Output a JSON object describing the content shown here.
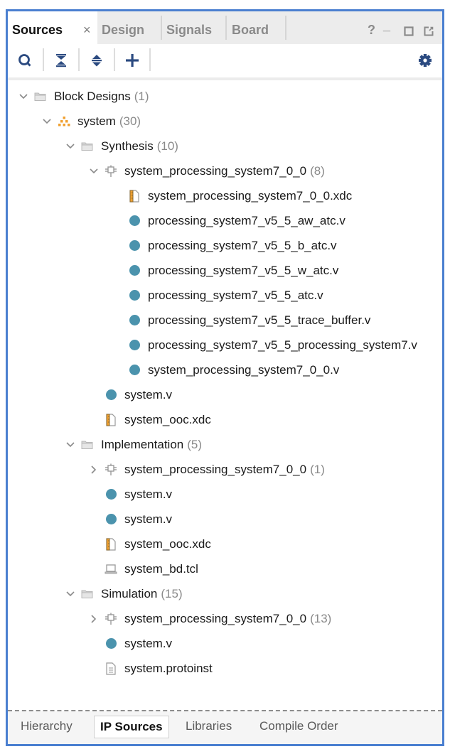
{
  "window": {
    "tabs": [
      {
        "label": "Sources",
        "active": true,
        "closable": true
      },
      {
        "label": "Design",
        "active": false
      },
      {
        "label": "Signals",
        "active": false
      },
      {
        "label": "Board",
        "active": false
      }
    ],
    "close_glyph": "×",
    "controls": {
      "help": "?",
      "minimize": "_",
      "maximize": "maximize-icon",
      "float": "float-icon"
    }
  },
  "toolbar": {
    "buttons": [
      {
        "name": "search",
        "icon": "search-icon"
      },
      {
        "name": "collapse-all",
        "icon": "collapse-all-icon"
      },
      {
        "name": "expand-all",
        "icon": "expand-all-icon"
      },
      {
        "name": "add-sources",
        "icon": "plus-icon"
      }
    ],
    "settings_icon": "gear-icon"
  },
  "tree": {
    "rows": [
      {
        "label": "Block Designs",
        "count": "(1)",
        "level": 0,
        "icon": "folder",
        "expander": "expanded"
      },
      {
        "label": "system",
        "count": "(30)",
        "level": 1,
        "icon": "block-design",
        "expander": "expanded"
      },
      {
        "label": "Synthesis",
        "count": "(10)",
        "level": 2,
        "icon": "folder",
        "expander": "expanded"
      },
      {
        "label": "system_processing_system7_0_0",
        "count": "(8)",
        "level": 3,
        "icon": "ip",
        "expander": "expanded"
      },
      {
        "label": "system_processing_system7_0_0.xdc",
        "count": "",
        "level": 4,
        "icon": "xdc",
        "expander": "none"
      },
      {
        "label": "processing_system7_v5_5_aw_atc.v",
        "count": "",
        "level": 4,
        "icon": "verilog",
        "expander": "none"
      },
      {
        "label": "processing_system7_v5_5_b_atc.v",
        "count": "",
        "level": 4,
        "icon": "verilog",
        "expander": "none"
      },
      {
        "label": "processing_system7_v5_5_w_atc.v",
        "count": "",
        "level": 4,
        "icon": "verilog",
        "expander": "none"
      },
      {
        "label": "processing_system7_v5_5_atc.v",
        "count": "",
        "level": 4,
        "icon": "verilog",
        "expander": "none"
      },
      {
        "label": "processing_system7_v5_5_trace_buffer.v",
        "count": "",
        "level": 4,
        "icon": "verilog",
        "expander": "none"
      },
      {
        "label": "processing_system7_v5_5_processing_system7.v",
        "count": "",
        "level": 4,
        "icon": "verilog",
        "expander": "none"
      },
      {
        "label": "system_processing_system7_0_0.v",
        "count": "",
        "level": 4,
        "icon": "verilog",
        "expander": "none"
      },
      {
        "label": "system.v",
        "count": "",
        "level": 3,
        "icon": "verilog",
        "expander": "none"
      },
      {
        "label": "system_ooc.xdc",
        "count": "",
        "level": 3,
        "icon": "xdc",
        "expander": "none"
      },
      {
        "label": "Implementation",
        "count": "(5)",
        "level": 2,
        "icon": "folder",
        "expander": "expanded"
      },
      {
        "label": "system_processing_system7_0_0",
        "count": "(1)",
        "level": 3,
        "icon": "ip",
        "expander": "collapsed"
      },
      {
        "label": "system.v",
        "count": "",
        "level": 3,
        "icon": "verilog",
        "expander": "none"
      },
      {
        "label": "system.v",
        "count": "",
        "level": 3,
        "icon": "verilog",
        "expander": "none"
      },
      {
        "label": "system_ooc.xdc",
        "count": "",
        "level": 3,
        "icon": "xdc",
        "expander": "none"
      },
      {
        "label": "system_bd.tcl",
        "count": "",
        "level": 3,
        "icon": "tcl",
        "expander": "none"
      },
      {
        "label": "Simulation",
        "count": "(15)",
        "level": 2,
        "icon": "folder",
        "expander": "expanded"
      },
      {
        "label": "system_processing_system7_0_0",
        "count": "(13)",
        "level": 3,
        "icon": "ip",
        "expander": "collapsed"
      },
      {
        "label": "system.v",
        "count": "",
        "level": 3,
        "icon": "verilog",
        "expander": "none"
      },
      {
        "label": "system.protoinst",
        "count": "",
        "level": 3,
        "icon": "text-file",
        "expander": "none"
      }
    ]
  },
  "bottom_tabs": [
    {
      "label": "Hierarchy",
      "active": false
    },
    {
      "label": "IP Sources",
      "active": true
    },
    {
      "label": "Libraries",
      "active": false
    },
    {
      "label": "Compile Order",
      "active": false
    }
  ],
  "colors": {
    "frame_border": "#4a7fd0",
    "toolbar_icon": "#2b4a80",
    "verilog_dot": "#4b93ad",
    "block_design": "#f0a030",
    "count_text": "#8a8a8a"
  }
}
